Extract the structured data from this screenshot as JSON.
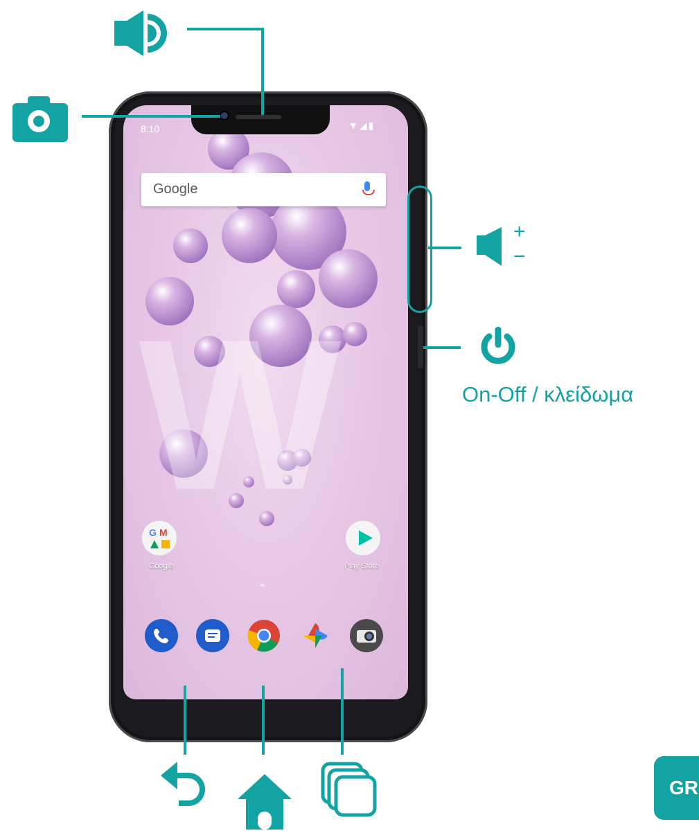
{
  "status_bar": {
    "time": "8:10",
    "signal_icons": "▼◢▮"
  },
  "search_widget": {
    "brand": "Google",
    "icon": "mic-icon"
  },
  "home_apps": [
    {
      "label": "Google",
      "icon": "google-folder-icon"
    },
    {
      "label": "Play Store",
      "icon": "play-store-icon"
    }
  ],
  "dock": [
    "phone-icon",
    "messages-icon",
    "chrome-icon",
    "photos-icon",
    "camera-icon"
  ],
  "nav": {
    "back": "◁",
    "home": "○",
    "recents": "□"
  },
  "annotations": {
    "power_label": "On-Off / κλείδωμα",
    "volume_plus": "+",
    "volume_minus": "−",
    "language_badge": "GR"
  },
  "colors": {
    "accent": "#13a3a3",
    "wallpaper": "#e8c9e6"
  }
}
